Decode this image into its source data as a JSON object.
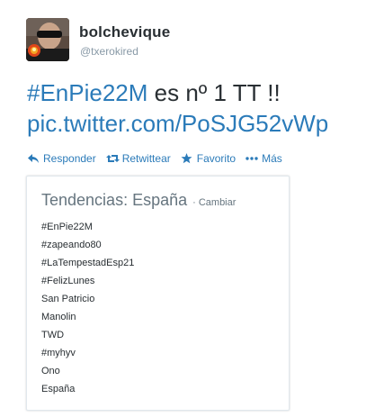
{
  "tweet": {
    "fullname": "bolchevique",
    "screenname": "@txerokired",
    "hashtag": "#EnPie22M",
    "text_middle": " es nº 1 TT !!",
    "link": "pic.twitter.com/PoSJG52vWp"
  },
  "actions": {
    "reply": "Responder",
    "retweet": "Retwittear",
    "favorite": "Favorito",
    "more": "Más"
  },
  "icons": {
    "reply": "reply-icon",
    "retweet": "retweet-icon",
    "favorite": "star-icon",
    "more": "ellipsis-icon"
  },
  "trends": {
    "title": "Tendencias: España",
    "change": "· Cambiar",
    "items": [
      "#EnPie22M",
      "#zapeando80",
      "#LaTempestadEsp21",
      "#FelizLunes",
      "San Patricio",
      "Manolin",
      "TWD",
      "#myhyv",
      "Ono",
      "España"
    ]
  },
  "colors": {
    "link": "#2b7bb9",
    "text": "#292f33",
    "muted": "#8899a6"
  }
}
